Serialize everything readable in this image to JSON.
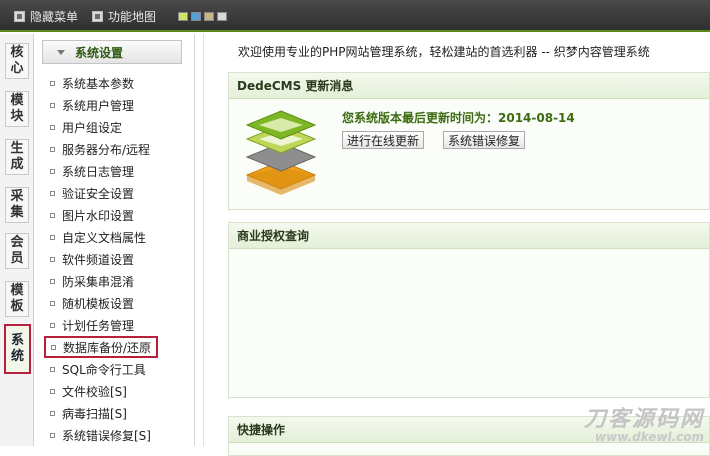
{
  "topbar": {
    "hide_menu_label": "隐藏菜单",
    "function_map_label": "功能地图",
    "skin_colors": [
      "#d6e36a",
      "#5aa0d8",
      "#c9b48a",
      "#d8d8d8"
    ]
  },
  "tabs": [
    {
      "chars": [
        "核",
        "心"
      ]
    },
    {
      "chars": [
        "模",
        "块"
      ]
    },
    {
      "chars": [
        "生",
        "成"
      ]
    },
    {
      "chars": [
        "采",
        "集"
      ]
    },
    {
      "chars": [
        "会",
        "员"
      ]
    },
    {
      "chars": [
        "模",
        "板"
      ]
    },
    {
      "chars": [
        "系",
        "统"
      ],
      "active": true
    }
  ],
  "sidebar": {
    "header": "系统设置",
    "items": [
      {
        "label": "系统基本参数"
      },
      {
        "label": "系统用户管理"
      },
      {
        "label": "用户组设定"
      },
      {
        "label": "服务器分布/远程"
      },
      {
        "label": "系统日志管理"
      },
      {
        "label": "验证安全设置"
      },
      {
        "label": "图片水印设置"
      },
      {
        "label": "自定义文档属性"
      },
      {
        "label": "软件频道设置"
      },
      {
        "label": "防采集串混淆"
      },
      {
        "label": "随机模板设置"
      },
      {
        "label": "计划任务管理"
      },
      {
        "label": "数据库备份/还原",
        "highlight": true
      },
      {
        "label": "SQL命令行工具"
      },
      {
        "label": "文件校验[S]"
      },
      {
        "label": "病毒扫描[S]"
      },
      {
        "label": "系统错误修复[S]"
      }
    ]
  },
  "main": {
    "welcome": "欢迎使用专业的PHP网站管理系统，轻松建站的首选利器 -- 织梦内容管理系统",
    "update_panel": {
      "title": "DedeCMS 更新消息",
      "last_update": "您系统版本最后更新时间为：2014-08-14",
      "online_update_button": "进行在线更新",
      "fix_button": "系统错误修复"
    },
    "license_panel": {
      "title": "商业授权查询"
    },
    "quick_panel": {
      "title": "快捷操作"
    }
  },
  "watermark": {
    "title": "刀客源码网",
    "url": "www.dkewl.com"
  }
}
